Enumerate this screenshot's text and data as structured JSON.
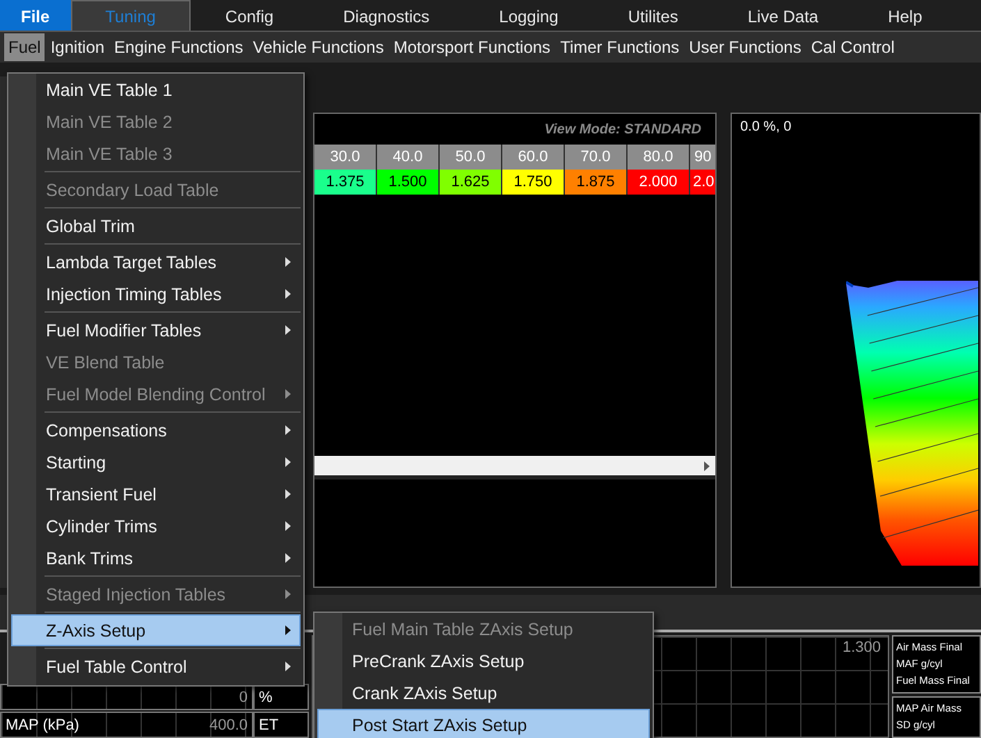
{
  "menu_bar": [
    {
      "label": "File",
      "kind": "file",
      "selected": false
    },
    {
      "label": "Tuning",
      "kind": "tab",
      "selected": true
    },
    {
      "label": "Config",
      "kind": "tab",
      "selected": false
    },
    {
      "label": "Diagnostics",
      "kind": "tab",
      "selected": false
    },
    {
      "label": "Logging",
      "kind": "tab",
      "selected": false
    },
    {
      "label": "Utilites",
      "kind": "tab",
      "selected": false
    },
    {
      "label": "Live Data",
      "kind": "tab",
      "selected": false
    },
    {
      "label": "Help",
      "kind": "tab",
      "selected": false
    }
  ],
  "sub_menu_bar": [
    {
      "label": "Fuel",
      "selected": true
    },
    {
      "label": "Ignition",
      "selected": false
    },
    {
      "label": "Engine Functions",
      "selected": false
    },
    {
      "label": "Vehicle Functions",
      "selected": false
    },
    {
      "label": "Motorsport Functions",
      "selected": false
    },
    {
      "label": "Timer Functions",
      "selected": false
    },
    {
      "label": "User Functions",
      "selected": false
    },
    {
      "label": "Cal Control",
      "selected": false
    }
  ],
  "table": {
    "view_mode": "View Mode: STANDARD",
    "columns": [
      "30.0",
      "40.0",
      "50.0",
      "60.0",
      "70.0",
      "80.0",
      "90"
    ],
    "cells": [
      {
        "value": "1.375",
        "color": "#1aff8c"
      },
      {
        "value": "1.500",
        "color": "#00ff00"
      },
      {
        "value": "1.625",
        "color": "#80ff00"
      },
      {
        "value": "1.750",
        "color": "#ffff00"
      },
      {
        "value": "1.875",
        "color": "#ff8000"
      },
      {
        "value": "2.000",
        "color": "#ff0000"
      },
      {
        "value": "2.0",
        "color": "#ff0000"
      }
    ]
  },
  "view_3d": {
    "cursor": "0.0 %, 0"
  },
  "gauges": [
    {
      "value": "0",
      "unit": "%"
    },
    {
      "label": "MAP (kPa)",
      "value": "400.0",
      "unit": "ET"
    }
  ],
  "graph": {
    "max": "1.300"
  },
  "channel_groups": [
    [
      "Air Mass Final",
      "MAF g/cyl",
      "Fuel Mass Final"
    ],
    [
      "MAP Air Mass",
      "SD g/cyl"
    ]
  ],
  "fuel_menu": [
    [
      {
        "label": "Main VE Table 1",
        "disabled": false,
        "submenu": false,
        "selected": false
      },
      {
        "label": "Main VE Table 2",
        "disabled": true,
        "submenu": false,
        "selected": false
      },
      {
        "label": "Main VE Table 3",
        "disabled": true,
        "submenu": false,
        "selected": false
      }
    ],
    [
      {
        "label": "Secondary Load Table",
        "disabled": true,
        "submenu": false,
        "selected": false
      }
    ],
    [
      {
        "label": "Global Trim",
        "disabled": false,
        "submenu": false,
        "selected": false
      }
    ],
    [
      {
        "label": "Lambda Target Tables",
        "disabled": false,
        "submenu": true,
        "selected": false
      },
      {
        "label": "Injection Timing Tables",
        "disabled": false,
        "submenu": true,
        "selected": false
      }
    ],
    [
      {
        "label": "Fuel Modifier Tables",
        "disabled": false,
        "submenu": true,
        "selected": false
      },
      {
        "label": "VE Blend Table",
        "disabled": true,
        "submenu": false,
        "selected": false
      },
      {
        "label": "Fuel Model Blending Control",
        "disabled": true,
        "submenu": true,
        "selected": false
      }
    ],
    [
      {
        "label": "Compensations",
        "disabled": false,
        "submenu": true,
        "selected": false
      },
      {
        "label": "Starting",
        "disabled": false,
        "submenu": true,
        "selected": false
      },
      {
        "label": "Transient Fuel",
        "disabled": false,
        "submenu": true,
        "selected": false
      },
      {
        "label": "Cylinder Trims",
        "disabled": false,
        "submenu": true,
        "selected": false
      },
      {
        "label": "Bank Trims",
        "disabled": false,
        "submenu": true,
        "selected": false
      }
    ],
    [
      {
        "label": "Staged Injection Tables",
        "disabled": true,
        "submenu": true,
        "selected": false
      }
    ],
    [
      {
        "label": "Z-Axis Setup",
        "disabled": false,
        "submenu": true,
        "selected": true
      }
    ],
    [
      {
        "label": "Fuel Table Control",
        "disabled": false,
        "submenu": true,
        "selected": false
      }
    ]
  ],
  "zaxis_menu": [
    {
      "label": "Fuel Main Table ZAxis Setup",
      "disabled": true,
      "selected": false
    },
    {
      "label": "PreCrank ZAxis Setup",
      "disabled": false,
      "selected": false
    },
    {
      "label": "Crank ZAxis Setup",
      "disabled": false,
      "selected": false
    },
    {
      "label": "Post Start ZAxis Setup",
      "disabled": false,
      "selected": true
    }
  ]
}
